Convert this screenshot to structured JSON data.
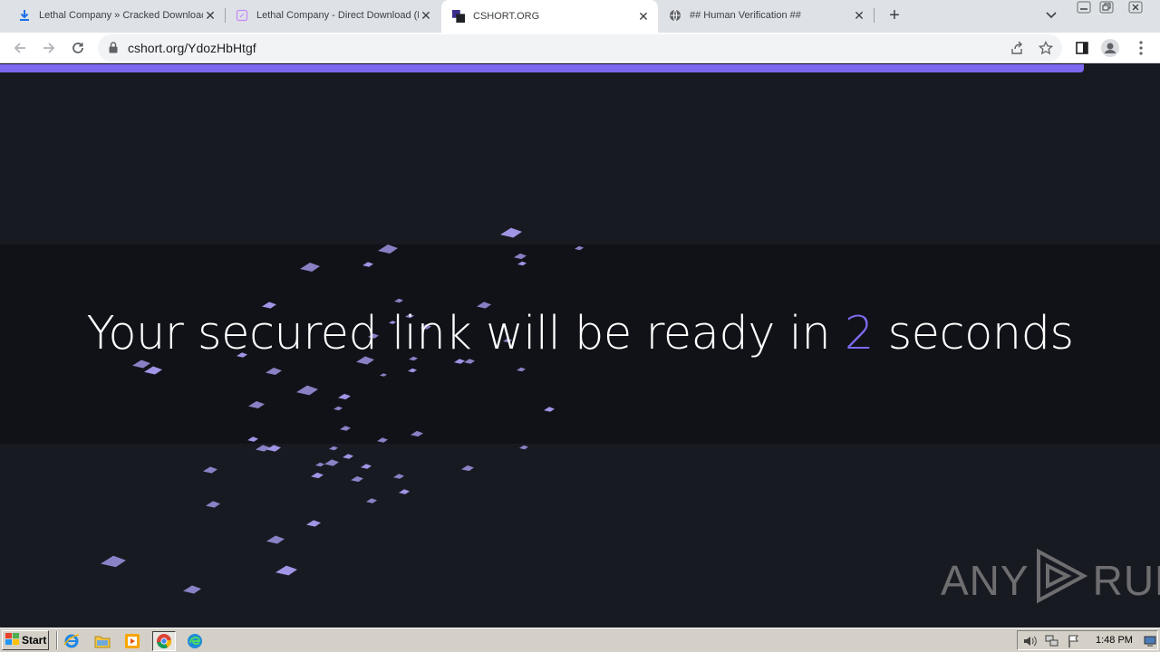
{
  "browser": {
    "tabs": [
      {
        "title": "Lethal Company » Cracked Downloads",
        "favicon": "download-icon",
        "active": false
      },
      {
        "title": "Lethal Company - Direct Download (R",
        "favicon": "page-icon",
        "active": false
      },
      {
        "title": "CSHORT.ORG",
        "favicon": "cshort-logo",
        "active": true
      },
      {
        "title": "## Human Verification ##",
        "favicon": "globe-icon",
        "active": false
      }
    ],
    "url": "cshort.org/YdozHbHtgf"
  },
  "page": {
    "message_before": "Your secured link will be ready in",
    "countdown": "2",
    "message_after": "seconds",
    "progress": 0.934,
    "accent_color": "#7b68ee",
    "particle_color": "#a89cf0",
    "background_color": "#181a22"
  },
  "watermark": {
    "left": "ANY",
    "right": "RUN"
  },
  "taskbar": {
    "start_label": "Start",
    "clock": "1:48 PM"
  }
}
